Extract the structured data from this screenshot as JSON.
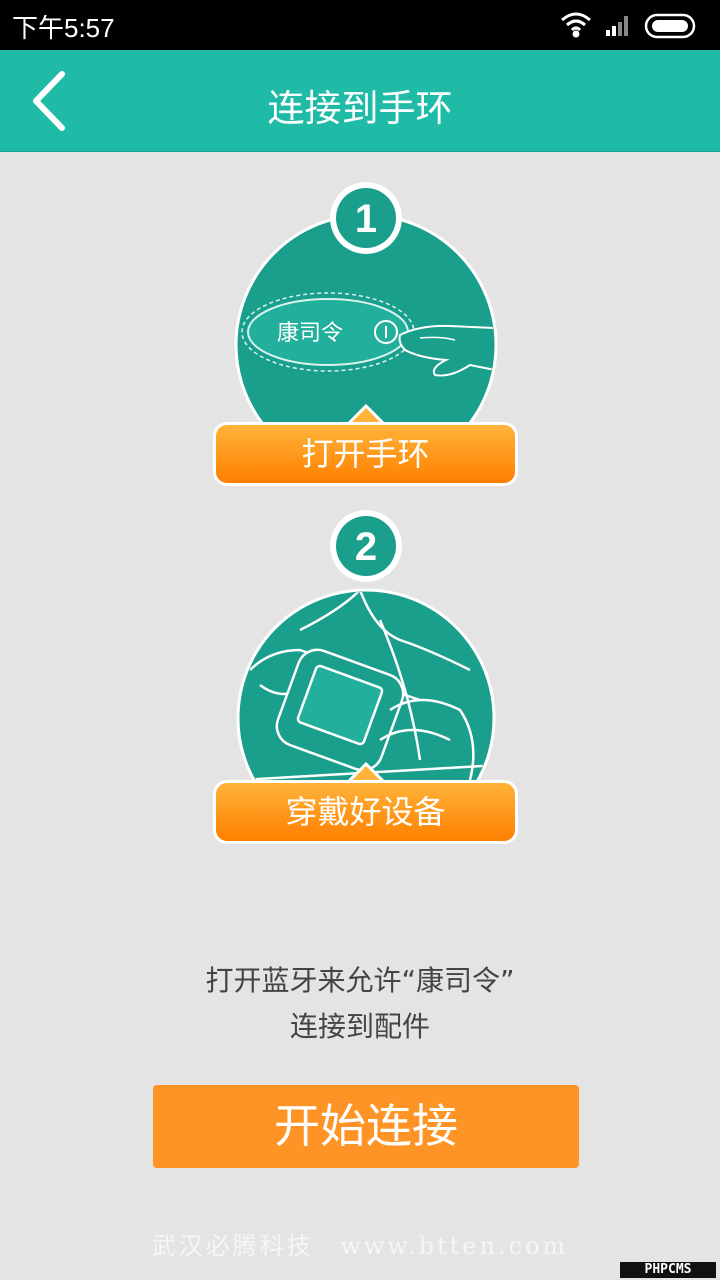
{
  "status_bar": {
    "time": "下午5:57"
  },
  "header": {
    "title": "连接到手环"
  },
  "steps": [
    {
      "number": "1",
      "label": "打开手环",
      "device_text": "康司令"
    },
    {
      "number": "2",
      "label": "穿戴好设备"
    }
  ],
  "hint": {
    "line1": "打开蓝牙来允许“康司令”",
    "line2": "连接到配件"
  },
  "start_button": {
    "label": "开始连接"
  },
  "footer": {
    "company": "武汉必腾科技",
    "url": "www.btten.com"
  },
  "watermark": "PHPCMS",
  "colors": {
    "teal_header": "#1fbba6",
    "teal_circle": "#1a9f8c",
    "orange_pill": "#ff8a10",
    "orange_button": "#ff9426",
    "background": "#e4e4e4"
  }
}
